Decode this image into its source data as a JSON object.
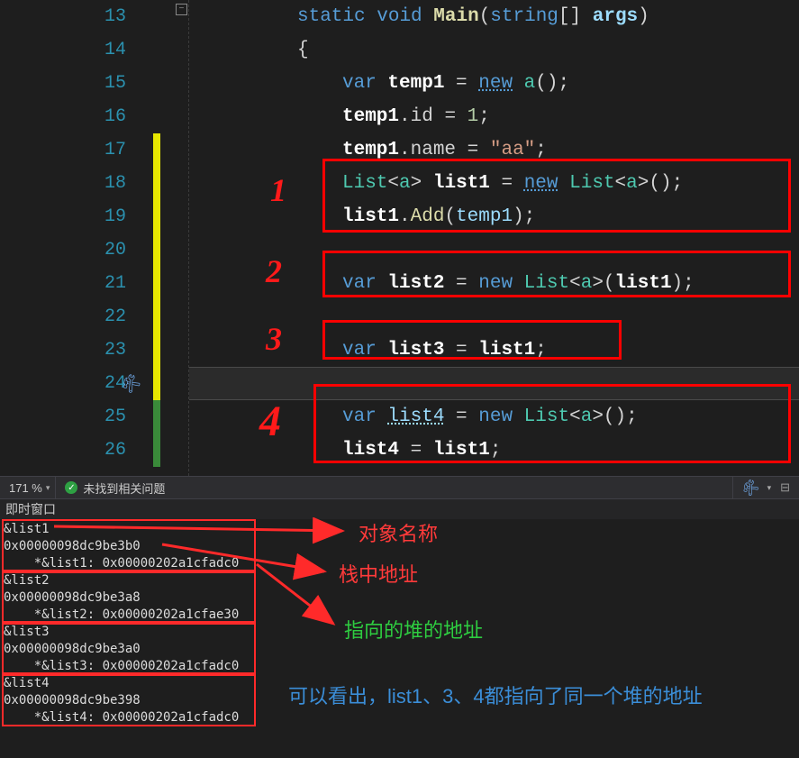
{
  "editor": {
    "lines": [
      "13",
      "14",
      "15",
      "16",
      "17",
      "18",
      "19",
      "20",
      "21",
      "22",
      "23",
      "24",
      "25",
      "26"
    ],
    "row13": {
      "static": "static",
      "void": "void",
      "main": "Main",
      "p1": "(",
      "string": "string",
      "br": "[]",
      "args": "args",
      "p2": ")"
    },
    "row14": {
      "brace": "{"
    },
    "row15": {
      "var": "var",
      "name": "temp1",
      "eq": " = ",
      "new": "new",
      "typ": "a",
      "call": "();"
    },
    "row16": {
      "name": "temp1",
      "dot": ".",
      "id": "id",
      "eq": " = ",
      "val": "1",
      "semi": ";"
    },
    "row17": {
      "name": "temp1",
      "dot": ".",
      "prop": "name",
      "eq": " = ",
      "str": "\"aa\"",
      "semi": ";"
    },
    "row18": {
      "list": "List",
      "b1": "<",
      "a": "a",
      "b2": ">",
      "name": "list1",
      "eq": " = ",
      "new": "new",
      "list2": "List",
      "b3": "<",
      "a2": "a",
      "b4": ">",
      "call": "();"
    },
    "row19": {
      "name": "list1",
      "dot": ".",
      "add": "Add",
      "p1": "(",
      "arg": "temp1",
      "p2": ");"
    },
    "row21": {
      "var": "var",
      "name": "list2",
      "eq": " = ",
      "new": "new",
      "list": "List",
      "b1": "<",
      "a": "a",
      "b2": ">",
      "p1": "(",
      "arg": "list1",
      "p2": ");"
    },
    "row23": {
      "var": "var",
      "name": "list3",
      "eq": " = ",
      "rhs": "list1",
      "semi": ";"
    },
    "row25": {
      "var": "var",
      "name": "list4",
      "eq": " = ",
      "new": "new",
      "list": "List",
      "b1": "<",
      "a": "a",
      "b2": ">",
      "call": "();"
    },
    "row26": {
      "name": "list4",
      "eq": " = ",
      "rhs": "list1",
      "semi": ";"
    },
    "handwritten": {
      "n1": "1",
      "n2": "2",
      "n3": "3",
      "n4": "4"
    }
  },
  "status": {
    "zoom": "171 %",
    "no_issues": "未找到相关问题"
  },
  "immediate": {
    "title": "即时窗口",
    "lines": [
      "&list1",
      "0x00000098dc9be3b0",
      "    *&list1: 0x00000202a1cfadc0",
      "&list2",
      "0x00000098dc9be3a8",
      "    *&list2: 0x00000202a1cfae30",
      "&list3",
      "0x00000098dc9be3a0",
      "    *&list3: 0x00000202a1cfadc0",
      "&list4",
      "0x00000098dc9be398",
      "    *&list4: 0x00000202a1cfadc0"
    ]
  },
  "annotations": {
    "obj_name": "对象名称",
    "stack_addr": "栈中地址",
    "heap_addr": "指向的堆的地址",
    "summary": "可以看出，list1、3、4都指向了同一个堆的地址"
  }
}
